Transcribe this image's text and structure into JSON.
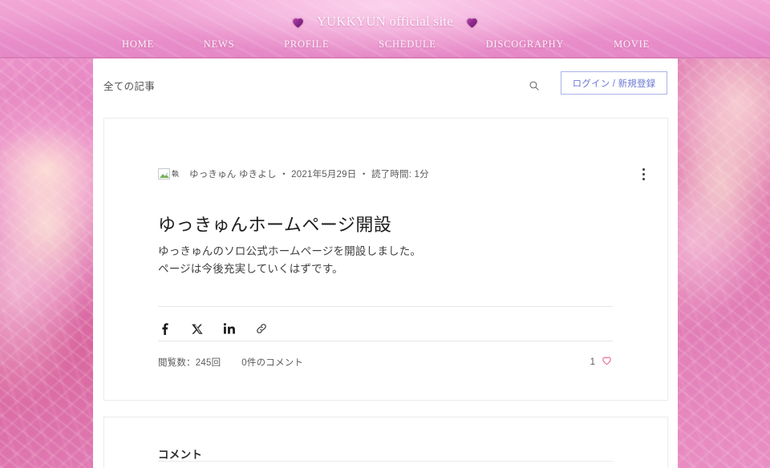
{
  "site": {
    "title": "YUKKYUN official site",
    "heart_color": "#8e2a8e",
    "header_pink": "#eea0d2",
    "nav": [
      {
        "label": "HOME"
      },
      {
        "label": "NEWS"
      },
      {
        "label": "PROFILE"
      },
      {
        "label": "SCHEDULE"
      },
      {
        "label": "DISCOGRAPHY"
      },
      {
        "label": "MOVIE"
      }
    ]
  },
  "blog_bar": {
    "all_posts_label": "全ての記事",
    "search_icon": "search-icon",
    "login_label": "ログイン / 新規登録",
    "login_color": "#6b78d6"
  },
  "post": {
    "avatar_alt": "執",
    "meta": "ゆっきゅん ゆきよし ・ 2021年5月29日 ・ 読了時間: 1分",
    "author": "ゆっきゅん ゆきよし",
    "date": "2021年5月29日",
    "read_time": "読了時間: 1分",
    "title": "ゆっきゅんホームページ開設",
    "body_line1": "ゆっきゅんのソロ公式ホームページを開設しました。",
    "body_line2": "ページは今後充実していくはずです。",
    "more_icon": "more-vertical-icon",
    "share": [
      {
        "icon": "facebook-icon",
        "label": "f"
      },
      {
        "icon": "x-twitter-icon",
        "label": "X"
      },
      {
        "icon": "linkedin-icon",
        "label": "in"
      },
      {
        "icon": "link-icon",
        "label": "link"
      }
    ],
    "views_label": "閲覧数：245回",
    "views_count": 245,
    "comments_label": "0件のコメント",
    "comments_count": 0,
    "like_count": "1",
    "like_icon": "heart-outline-icon",
    "like_color": "#e8718c"
  },
  "comments": {
    "title": "コメント"
  }
}
